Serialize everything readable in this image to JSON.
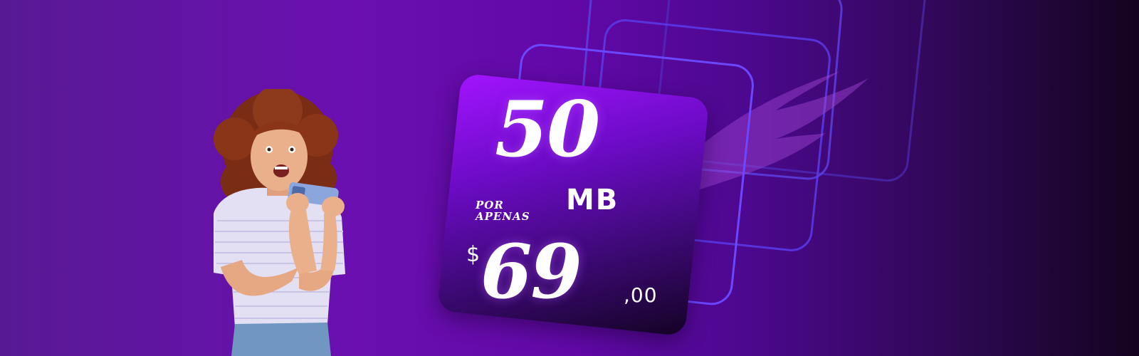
{
  "offer": {
    "data_amount": "50",
    "data_unit": "MB",
    "promo_text": "POR APENAS",
    "currency": "$",
    "price_integer": "69",
    "price_decimal": ",00"
  },
  "colors": {
    "background_left": "#581a94",
    "background_right": "#14031f",
    "card_top": "#a214ff",
    "card_bottom": "#140224",
    "frame_outline": "#6a49f5"
  },
  "icons": [
    "wing-icon"
  ]
}
